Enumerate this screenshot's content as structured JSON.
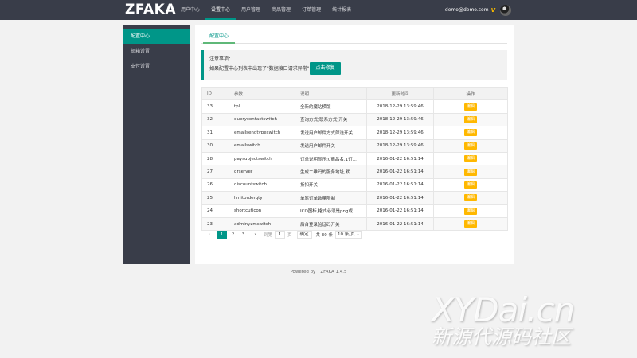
{
  "header": {
    "logo": "ZFAKA",
    "nav": [
      "用户中心",
      "设置中心",
      "用户管理",
      "商品管理",
      "订单管理",
      "统计报表"
    ],
    "active_nav": 1,
    "user_email": "demo@demo.com",
    "badge": "V",
    "accent_color": "#009688"
  },
  "sidebar": {
    "items": [
      "配置中心",
      "邮箱设置",
      "支付设置"
    ],
    "active": 0
  },
  "main": {
    "tab": "配置中心",
    "notice": {
      "title": "注意事项：",
      "text": "如果配置中心列表中出现了\"数据接口请求异常\"，",
      "button": "点击修复"
    },
    "table": {
      "headers": [
        "ID",
        "参数",
        "说明",
        "更新时间",
        "操作"
      ],
      "rows": [
        {
          "id": "33",
          "param": "tpl",
          "desc": "全新的魔站模版",
          "time": "2018-12-29 13:59:46"
        },
        {
          "id": "32",
          "param": "querycontactswitch",
          "desc": "查询方式(联系方式)开关",
          "time": "2018-12-29 13:59:46"
        },
        {
          "id": "31",
          "param": "emailsendtypeswitch",
          "desc": "发送用户邮件方式筛选开关",
          "time": "2018-12-29 13:59:46"
        },
        {
          "id": "30",
          "param": "emailswitch",
          "desc": "发送用户邮件开关",
          "time": "2018-12-29 13:59:46"
        },
        {
          "id": "28",
          "param": "paysubjectswitch",
          "desc": "订单说明显示:0商品名,1订...",
          "time": "2016-01-22 16:51:14"
        },
        {
          "id": "27",
          "param": "qrserver",
          "desc": "生成二维码的服务地址,默...",
          "time": "2016-01-22 16:51:14"
        },
        {
          "id": "26",
          "param": "discountswitch",
          "desc": "折扣开关",
          "time": "2016-01-22 16:51:14"
        },
        {
          "id": "25",
          "param": "limitorderqty",
          "desc": "单笔订单数量限制",
          "time": "2016-01-22 16:51:14"
        },
        {
          "id": "24",
          "param": "shortcuticon",
          "desc": "ICO图标,格式必须是png或...",
          "time": "2016-01-22 16:51:14"
        },
        {
          "id": "23",
          "param": "adminyzmswitch",
          "desc": "后台登录验证码开关",
          "time": "2016-01-22 16:51:14"
        }
      ],
      "edit_label": "编辑"
    },
    "pager": {
      "prev": "‹",
      "pages": [
        "1",
        "2",
        "3"
      ],
      "current": "1",
      "next": "›",
      "goto_label": "到第",
      "goto_value": "1",
      "page_unit": "页",
      "confirm": "确定",
      "total": "共 30 条",
      "per_page": "10 条/页"
    }
  },
  "footer": {
    "powered": "Powered by",
    "brand": "ZFAKA 1.4.5"
  },
  "watermark": {
    "line1": "XYDai.cn",
    "line2": "新源代源码社区"
  }
}
